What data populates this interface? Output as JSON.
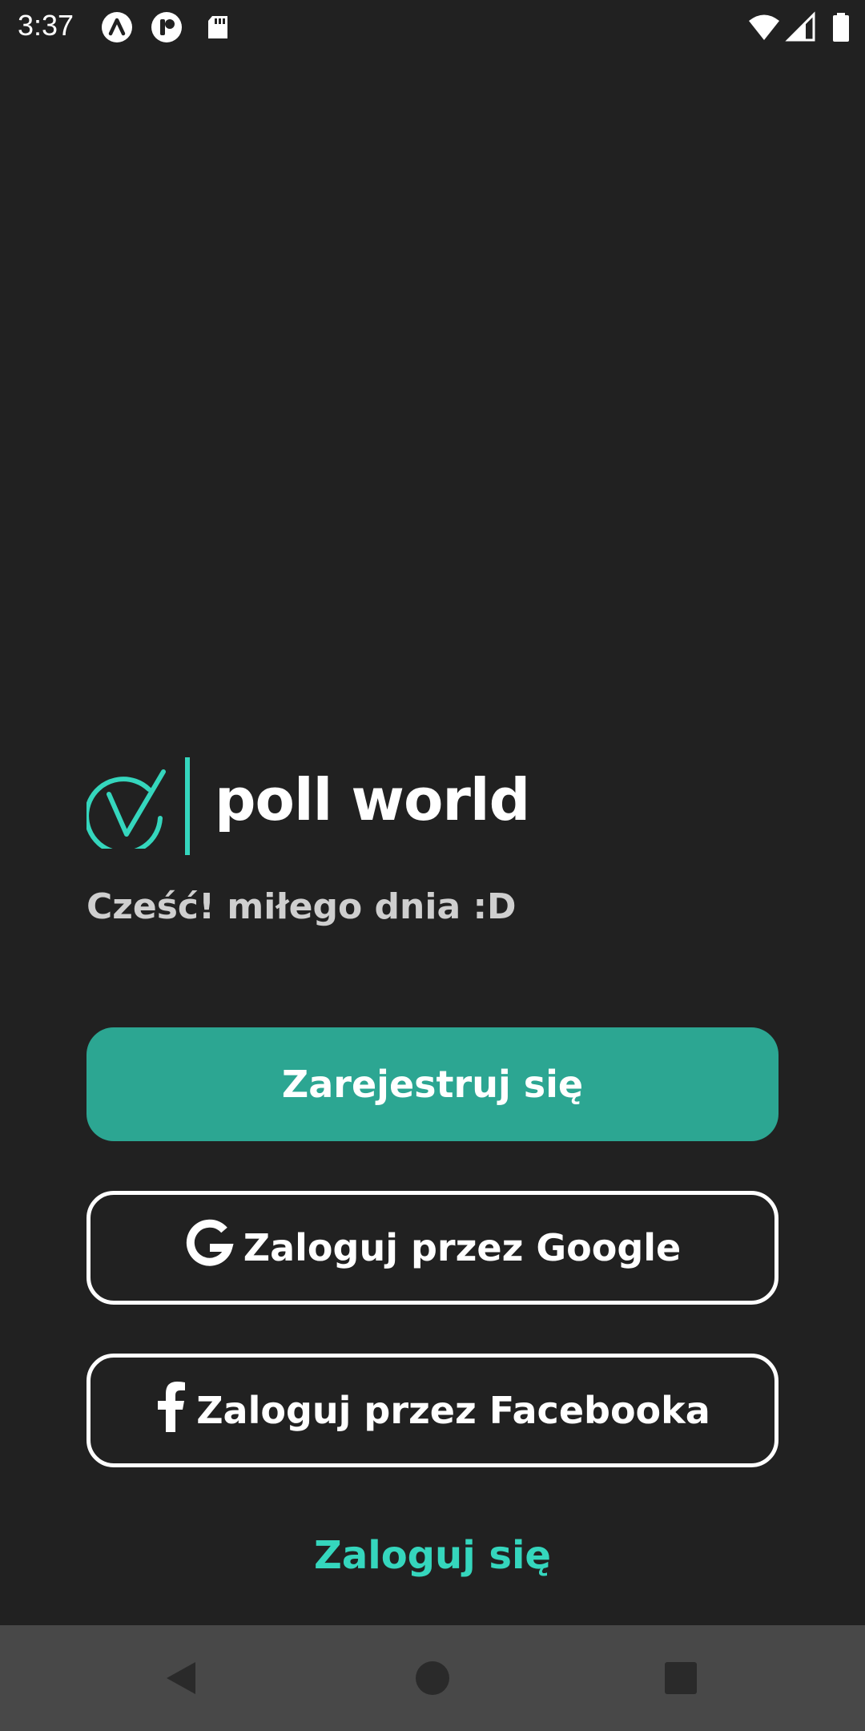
{
  "status_bar": {
    "time": "3:37",
    "icons_left": [
      "app-a-icon",
      "app-p-icon",
      "sd-card-icon"
    ],
    "icons_right": [
      "wifi-icon",
      "signal-icon",
      "battery-icon"
    ]
  },
  "brand": {
    "name": "poll world",
    "accent_color": "#35d6bd"
  },
  "greeting": "Cześć! miłego dnia :D",
  "buttons": {
    "register": "Zarejestruj się",
    "google": "Zaloguj przez Google",
    "facebook": "Zaloguj przez Facebooka"
  },
  "login_link": "Zaloguj się",
  "nav_bar": {
    "buttons": [
      "back-icon",
      "home-icon",
      "recents-icon"
    ]
  },
  "colors": {
    "background": "#212121",
    "primary_button": "#2ca692",
    "nav_bar": "#484848"
  }
}
